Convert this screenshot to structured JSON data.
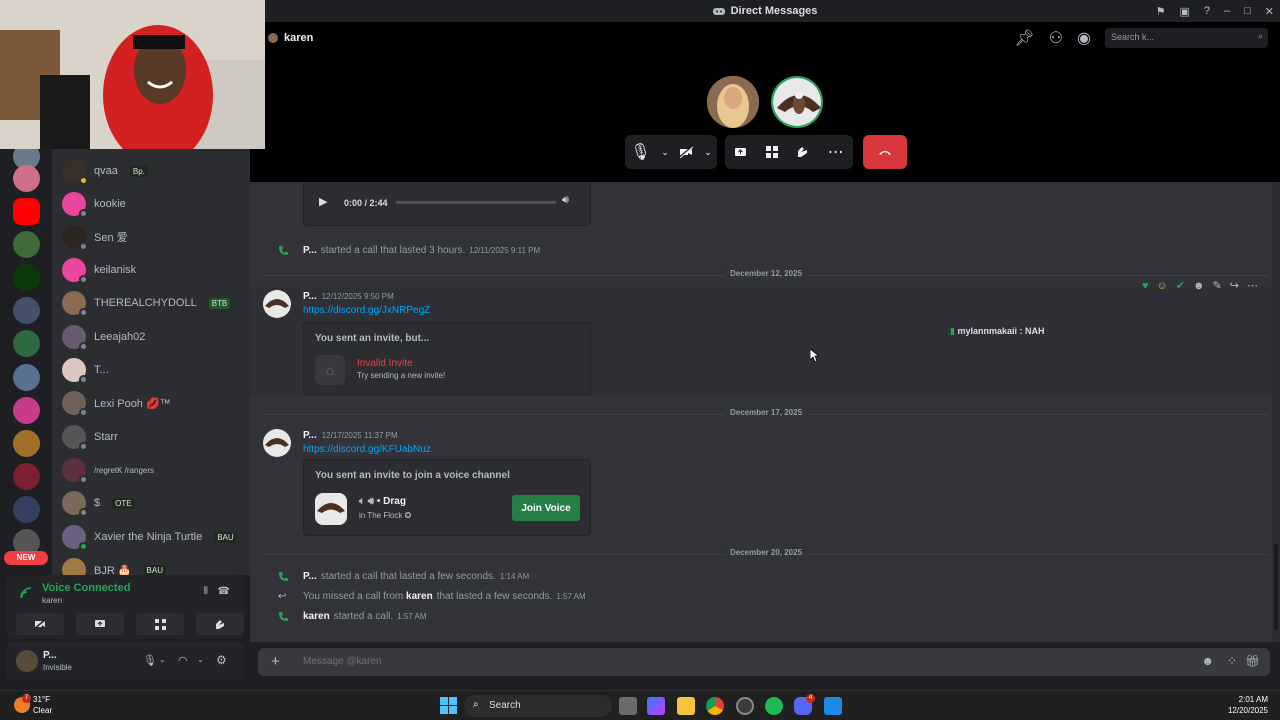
{
  "window": {
    "title": "Direct Messages"
  },
  "call": {
    "recipient": "karen",
    "search_placeholder": "Search k..."
  },
  "dm_list": [
    {
      "name": "qvaa",
      "tag": "Bp.",
      "status_color": "#80848e"
    },
    {
      "name": "kookie",
      "tag": "",
      "status_color": "#80848e"
    },
    {
      "name": "Sen 爱",
      "tag": "",
      "status_color": "#80848e"
    },
    {
      "name": "keilanisk",
      "tag": "",
      "status_color": "#80848e"
    },
    {
      "name": "THEREALCHYDOLL",
      "tag": "BTB",
      "status_color": "#80848e"
    },
    {
      "name": "Leeajah02",
      "tag": "",
      "status_color": "#80848e"
    },
    {
      "name": "T...",
      "tag": "",
      "status_color": "#80848e"
    },
    {
      "name": "Lexi Pooh 💋™",
      "tag": "",
      "status_color": "#80848e"
    },
    {
      "name": "Starr",
      "tag": "",
      "status_color": "#80848e"
    },
    {
      "name": "/regretK /rangers",
      "tag": "",
      "status_color": "#80848e"
    },
    {
      "name": "$",
      "tag": "OTE",
      "status_color": "#80848e"
    },
    {
      "name": "Xavier the Ninja Turtle",
      "tag": "BAU",
      "status_color": "#23a55a"
    },
    {
      "name": "BJR 🎂",
      "tag": "BAU",
      "status_color": "#80848e"
    }
  ],
  "new_badge": "NEW",
  "voice": {
    "status": "Voice Connected",
    "channel": "karen"
  },
  "user": {
    "name": "P...",
    "status": "Invisible"
  },
  "chat": {
    "audio": {
      "time": "0:00 / 2:44"
    },
    "call_1": {
      "user": "P...",
      "text": "started a call that lasted 3 hours.",
      "time": "12/11/2025 9:11 PM"
    },
    "date_1": "December 12, 2025",
    "msg_1": {
      "user": "P...",
      "time": "12/12/2025 9:50 PM",
      "link": "https://discord.gg/JxNRPegZ",
      "embed_title": "You sent an invite, but...",
      "invalid": "Invalid Invite",
      "invalid_sub": "Try sending a new invite!"
    },
    "float_note": "mylannmakaii : NAH",
    "date_2": "December 17, 2025",
    "msg_2": {
      "user": "P...",
      "time": "12/17/2025 11:37 PM",
      "link": "https://discord.gg/KFUabNuz",
      "embed_title": "You sent an invite to join a voice channel",
      "channel": "Drag",
      "server": "in The Flock",
      "join": "Join Voice"
    },
    "date_3": "December 20, 2025",
    "call_2": {
      "user": "P...",
      "text": "started a call that lasted a few seconds.",
      "time": "1:14 AM"
    },
    "call_3": {
      "pre": "You missed a call from",
      "user": "karen",
      "text": "that lasted a few seconds.",
      "time": "1:57 AM"
    },
    "call_4": {
      "user": "karen",
      "text": "started a call.",
      "time": "1:57 AM"
    }
  },
  "composer": {
    "placeholder": "Message @karen"
  },
  "taskbar": {
    "weather_temp": "31°F",
    "weather_desc": "Clear",
    "weather_badge": "7",
    "search": "Search",
    "time": "2:01 AM",
    "date": "12/20/2025",
    "discord_badge": "4"
  },
  "colors": {
    "accent_green": "#23a55a",
    "danger": "#da373c",
    "link": "#00a8fc"
  }
}
